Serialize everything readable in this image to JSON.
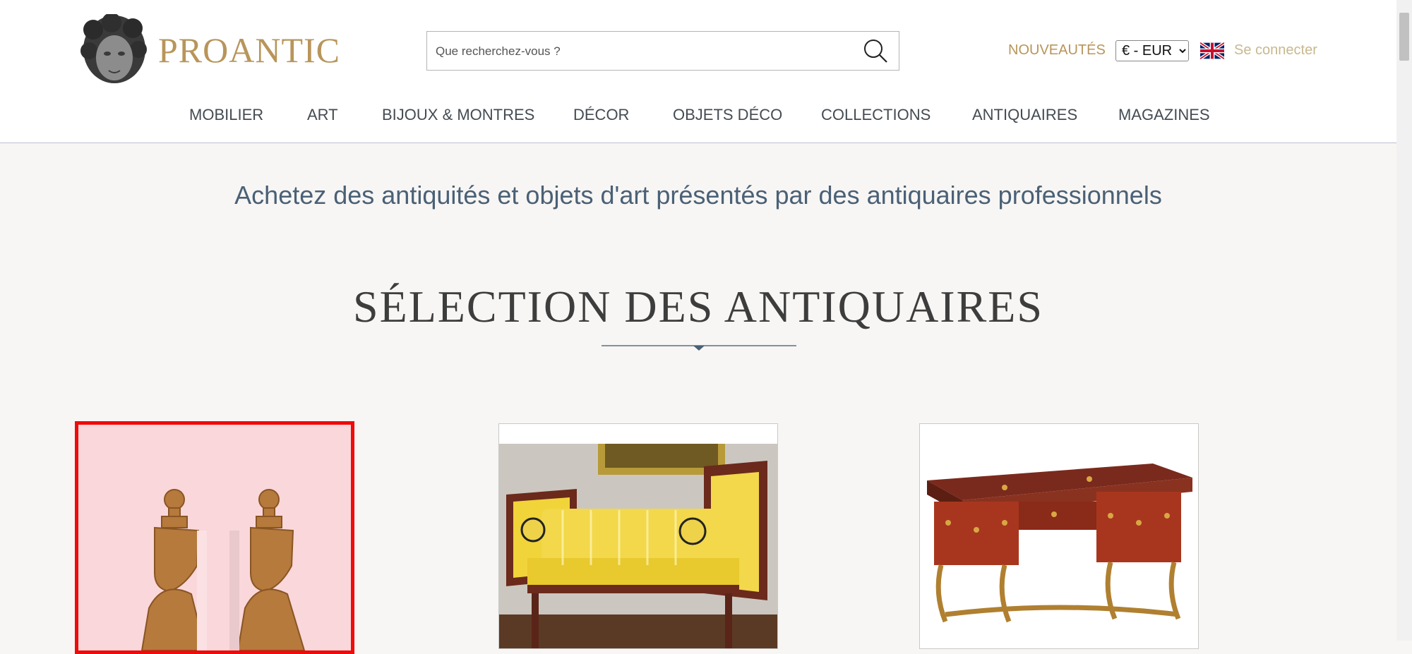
{
  "header": {
    "brand": "PROANTIC",
    "search": {
      "placeholder": "Que recherchez-vous ?"
    },
    "nouveautes": "NOUVEAUTÉS",
    "currency": {
      "selected": "€ - EUR"
    },
    "login": "Se connecter"
  },
  "nav": {
    "items": [
      "MOBILIER",
      "ART",
      "BIJOUX & MONTRES",
      "DÉCOR",
      "OBJETS DÉCO",
      "COLLECTIONS",
      "ANTIQUAIRES",
      "MAGAZINES"
    ]
  },
  "main": {
    "tagline": "Achetez des antiquités et objets d'art présentés par des antiquaires professionnels",
    "section_title": "SÉLECTION DES ANTIQUAIRES"
  },
  "colors": {
    "brand": "#b8955a",
    "nav_text": "#444b52",
    "tagline": "#4a6076",
    "selection_border": "#f00a0a"
  },
  "icons": [
    "search-icon",
    "uk-flag-icon",
    "logo-bust-icon",
    "divider-diamond-icon"
  ]
}
